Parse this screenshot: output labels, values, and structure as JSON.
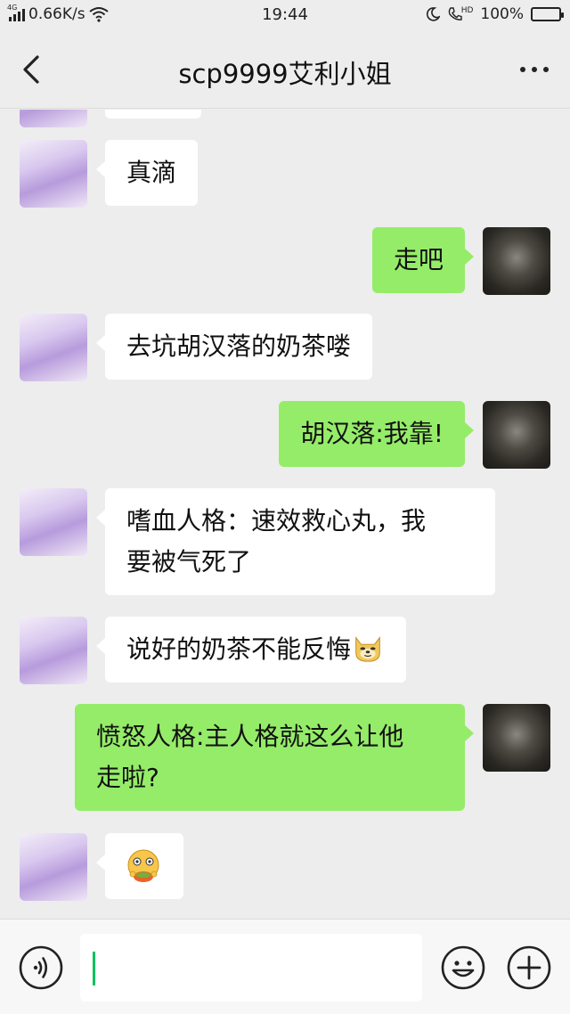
{
  "status_bar": {
    "network_tag": "4G",
    "speed": "0.66K/s",
    "time": "19:44",
    "hd_tag": "HD",
    "battery": "100%"
  },
  "nav": {
    "title": "scp9999艾利小姐"
  },
  "messages": [
    {
      "side": "in",
      "text": "真滴"
    },
    {
      "side": "out",
      "text": "走吧"
    },
    {
      "side": "in",
      "text": "去坑胡汉落的奶茶喽"
    },
    {
      "side": "out",
      "text": "胡汉落:我靠!"
    },
    {
      "side": "in",
      "line1": "嗜血人格：速效救心丸，我",
      "line2": "要被气死了"
    },
    {
      "side": "in",
      "text": "说好的奶茶不能反悔",
      "emoji": "doge-emoji"
    },
    {
      "side": "out",
      "line1": "愤怒人格:主人格就这么让他",
      "line2": "走啦?"
    },
    {
      "side": "in",
      "emoji": "eating-emoji"
    }
  ],
  "input_bar": {
    "value": ""
  },
  "colors": {
    "outgoing_bubble": "#95ec69",
    "incoming_bubble": "#ffffff",
    "background": "#ededed",
    "caret": "#07c160"
  },
  "icons": [
    "back-arrow-icon",
    "more-dots-icon",
    "voice-icon",
    "emoji-icon",
    "plus-icon",
    "wifi-icon",
    "moon-icon",
    "phone-hd-icon",
    "battery-icon",
    "signal-icon"
  ]
}
